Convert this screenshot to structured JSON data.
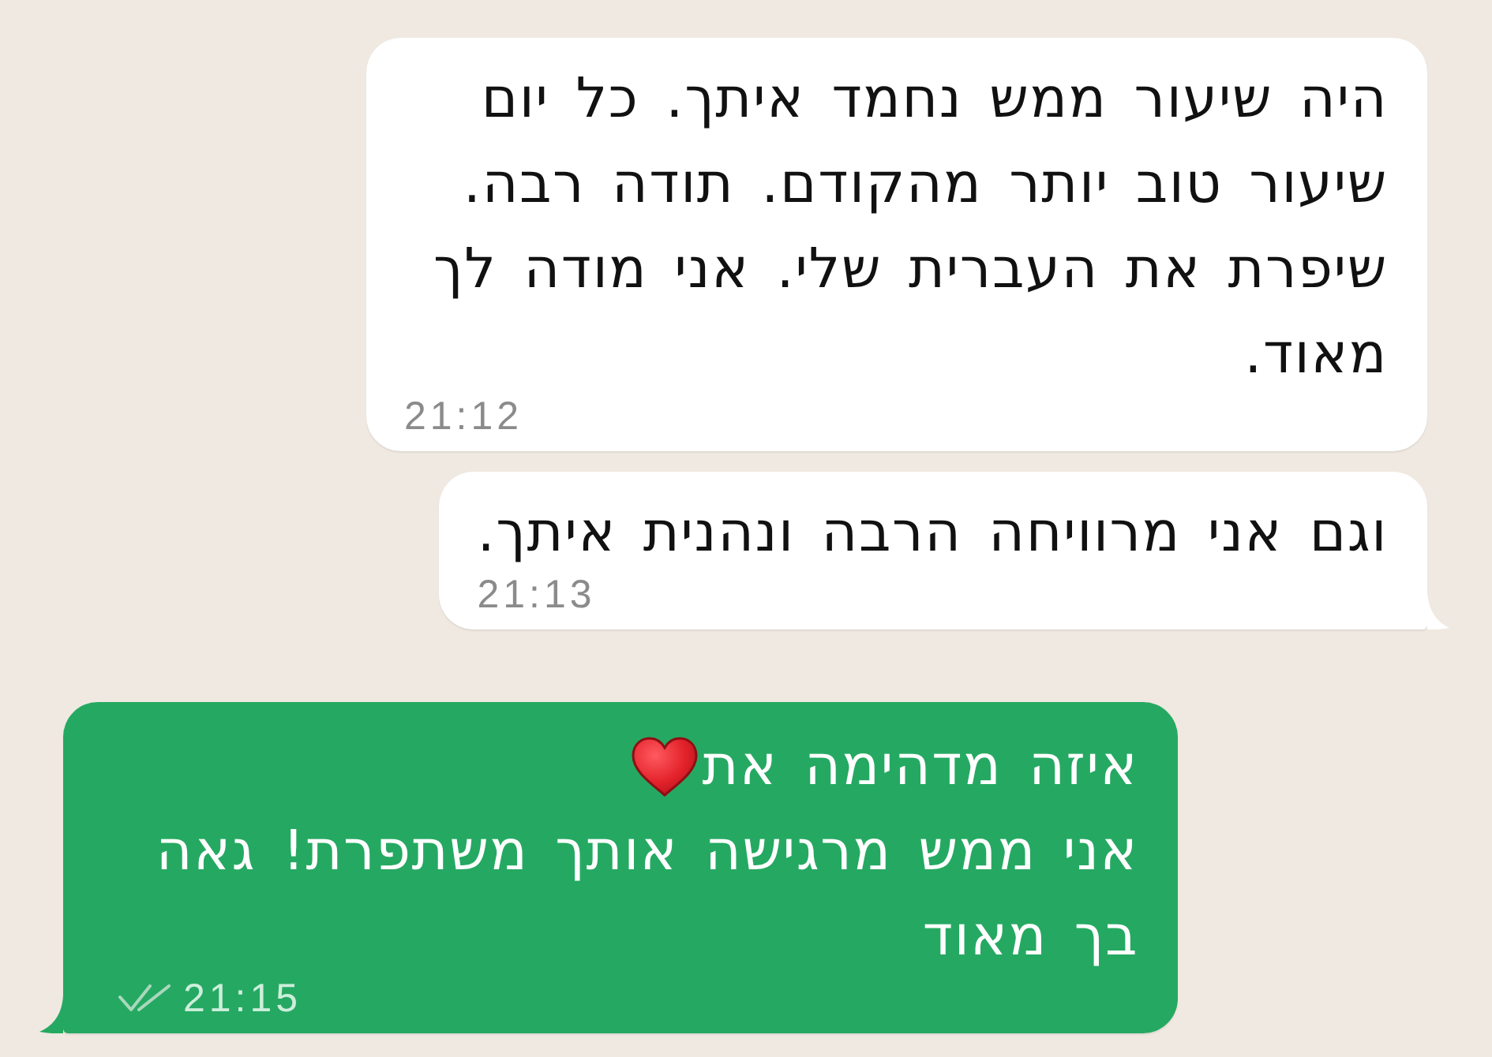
{
  "messages": [
    {
      "kind": "incoming",
      "tail": false,
      "paragraphs": [
        {
          "text": "היה שיעור ממש נחמד איתך. כל יום שיעור טוב יותר מהקודם. תודה רבה. שיפרת את העברית שלי. אני מודה לך מאוד.",
          "heart": false
        }
      ],
      "time": "21:12"
    },
    {
      "kind": "incoming",
      "tail": true,
      "paragraphs": [
        {
          "text": "וגם אני מרוויחה הרבה ונהנית איתך.",
          "heart": false
        }
      ],
      "time": "21:13"
    },
    {
      "kind": "outgoing",
      "tail": true,
      "paragraphs": [
        {
          "text": "איזה מדהימה את",
          "heart": true
        },
        {
          "text": "אני ממש מרגישה אותך משתפרת! גאה בך מאוד",
          "heart": false
        }
      ],
      "time": "21:15",
      "delivered": true,
      "read": false
    }
  ]
}
